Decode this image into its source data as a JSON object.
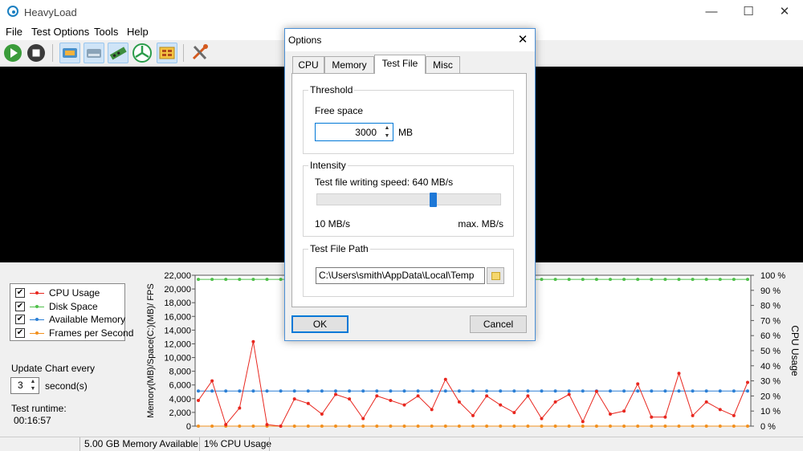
{
  "window": {
    "title": "HeavyLoad",
    "minimize": "—",
    "maximize": "☐",
    "close": "✕"
  },
  "menu": [
    "File",
    "Test Options",
    "Tools",
    "Help"
  ],
  "toolbar": {
    "buttons": [
      "start-icon",
      "stop-icon",
      "cpu-icon",
      "disk-icon",
      "memory-icon",
      "gpu-fan-icon",
      "test-file-icon",
      "options-tools-icon"
    ]
  },
  "legend": [
    {
      "label": "CPU Usage",
      "color": "#e8271f"
    },
    {
      "label": "Disk Space",
      "color": "#4fc04a"
    },
    {
      "label": "Available Memory",
      "color": "#2b7fd5"
    },
    {
      "label": "Frames per Second",
      "color": "#f2901e"
    }
  ],
  "update_chart": {
    "label": "Update Chart every",
    "value": "3",
    "unit": "second(s)"
  },
  "runtime": {
    "label": "Test runtime:",
    "value": "00:16:57"
  },
  "status": {
    "memory": "5.00 GB Memory Available",
    "cpu": "1% CPU Usage"
  },
  "chart_data": {
    "type": "line",
    "ylabel": "Memory(MB)/Space(C:)(MB)/ FPS",
    "y2label": "CPU Usage",
    "ylim": [
      0,
      22000
    ],
    "y2lim": [
      0,
      100
    ],
    "y_ticks": [
      "0",
      "2,000",
      "4,000",
      "6,000",
      "8,000",
      "10,000",
      "12,000",
      "14,000",
      "16,000",
      "18,000",
      "20,000",
      "22,000"
    ],
    "y2_ticks": [
      "0 %",
      "10 %",
      "20 %",
      "30 %",
      "40 %",
      "50 %",
      "60 %",
      "70 %",
      "80 %",
      "90 %",
      "100 %"
    ],
    "grid": false,
    "series": [
      {
        "name": "CPU Usage",
        "axis": "right",
        "values": [
          17,
          30,
          1,
          12,
          56,
          1,
          0,
          18,
          15,
          8,
          21,
          18,
          5,
          20,
          17,
          14,
          20,
          11,
          31,
          16,
          7,
          20,
          14,
          9,
          20,
          5,
          16,
          21,
          3,
          23,
          8,
          10,
          28,
          6,
          6,
          35,
          7,
          16,
          11,
          7,
          29
        ]
      },
      {
        "name": "Disk Space",
        "axis": "left",
        "values": [
          21400,
          21400,
          21400,
          21400,
          21400,
          21400,
          21400,
          21400,
          21400,
          21400,
          21400,
          21400,
          21400,
          21400,
          21400,
          21400,
          21400,
          21400,
          21400,
          21400,
          21400,
          21400,
          21400,
          21400,
          21400,
          21400,
          21400,
          21400,
          21400,
          21400,
          21400,
          21400,
          21400,
          21400,
          21400,
          21400,
          21400,
          21400,
          21400,
          21400,
          21400
        ]
      },
      {
        "name": "Available Memory",
        "axis": "left",
        "values": [
          5120,
          5120,
          5120,
          5120,
          5120,
          5120,
          5120,
          5120,
          5120,
          5120,
          5120,
          5120,
          5120,
          5120,
          5120,
          5120,
          5120,
          5120,
          5120,
          5120,
          5120,
          5120,
          5120,
          5120,
          5120,
          5120,
          5120,
          5120,
          5120,
          5120,
          5120,
          5120,
          5120,
          5120,
          5120,
          5120,
          5120,
          5120,
          5120,
          5120,
          5120
        ]
      },
      {
        "name": "Frames per Second",
        "axis": "left",
        "values": [
          0,
          0,
          0,
          0,
          0,
          0,
          0,
          0,
          0,
          0,
          0,
          0,
          0,
          0,
          0,
          0,
          0,
          0,
          0,
          0,
          0,
          0,
          0,
          0,
          0,
          0,
          0,
          0,
          0,
          0,
          0,
          0,
          0,
          0,
          0,
          0,
          0,
          0,
          0,
          0,
          0
        ]
      }
    ]
  },
  "dialog": {
    "title": "Options",
    "close": "✕",
    "tabs": [
      "CPU",
      "Memory",
      "Test File",
      "Misc"
    ],
    "active_tab": "Test File",
    "threshold": {
      "group": "Threshold",
      "label": "Free space",
      "value": "3000",
      "unit": "MB"
    },
    "intensity": {
      "group": "Intensity",
      "label": "Test file writing speed: 640 MB/s",
      "min_label": "10 MB/s",
      "max_label": "max. MB/s",
      "slider_fraction": 0.63
    },
    "path": {
      "group": "Test File Path",
      "value": "C:\\Users\\smith\\AppData\\Local\\Temp"
    },
    "ok": "OK",
    "cancel": "Cancel"
  }
}
